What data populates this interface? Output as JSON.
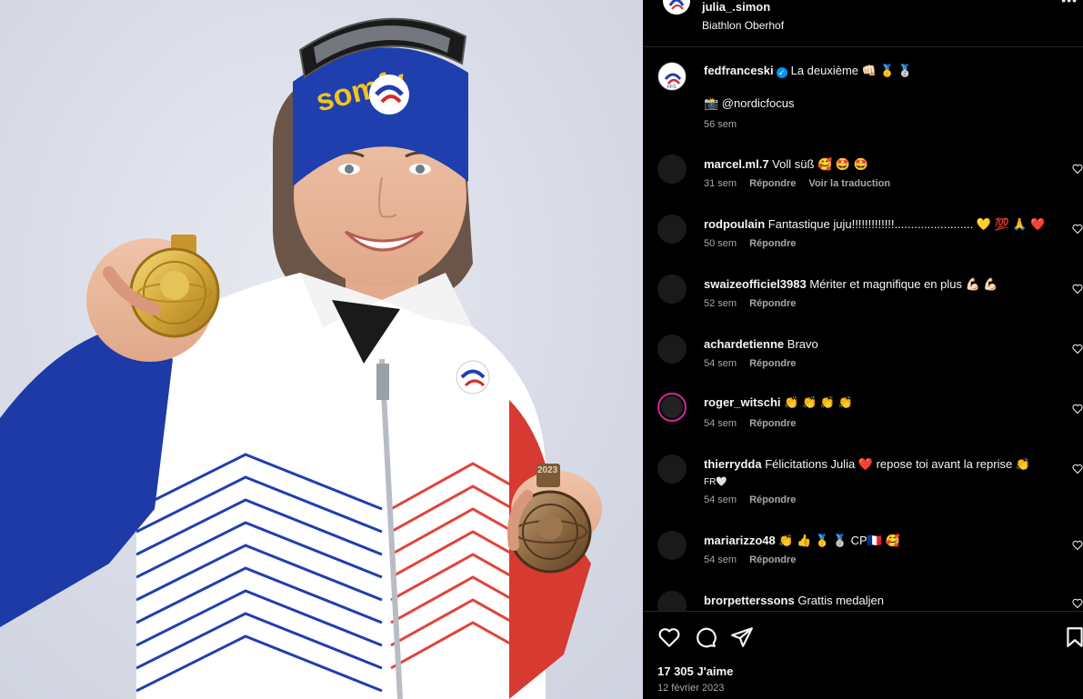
{
  "post": {
    "username": "julia_.simon",
    "location": "Biathlon Oberhof",
    "more": "•••"
  },
  "photo": {
    "headband_text": "somfy",
    "medal_year": "2023"
  },
  "caption": {
    "username": "fedfranceski",
    "verified_mark": "✓",
    "text": "La deuxième 👊🏻 🥇 🥈",
    "credit": "📸 @nordicfocus",
    "time": "56 sem"
  },
  "comments": [
    {
      "username": "marcel.ml.7",
      "text": "Voll süß 🥰 🤩 🤩",
      "time": "31 sem",
      "reply": "Répondre",
      "translate": "Voir la traduction"
    },
    {
      "username": "rodpoulain",
      "text": "Fantastique juju!!!!!!!!!!!!!........................ 💛 💯 🙏 ❤️",
      "time": "50 sem",
      "reply": "Répondre"
    },
    {
      "username": "swaizeofficiel3983",
      "text": "Mériter et magnifique en plus 💪🏻 💪🏻",
      "time": "52 sem",
      "reply": "Répondre"
    },
    {
      "username": "achardetienne",
      "text": "Bravo",
      "time": "54 sem",
      "reply": "Répondre"
    },
    {
      "username": "roger_witschi",
      "text": "👏 👏 👏 👏",
      "time": "54 sem",
      "reply": "Répondre"
    },
    {
      "username": "thierrydda",
      "text": "Félicitations Julia ❤️  repose toi avant la reprise 👏",
      "text2": "FR🤍",
      "time": "54 sem",
      "reply": "Répondre"
    },
    {
      "username": "mariarizzo48",
      "text": "👏 👍 🥇 🥈 CP🇫🇷 🥰",
      "time": "54 sem",
      "reply": "Répondre"
    },
    {
      "username": "brorpetterssons",
      "text": "Grattis medaljen",
      "time": "",
      "reply": ""
    }
  ],
  "footer": {
    "likes": "17 305 J'aime",
    "date": "12 février 2023"
  }
}
